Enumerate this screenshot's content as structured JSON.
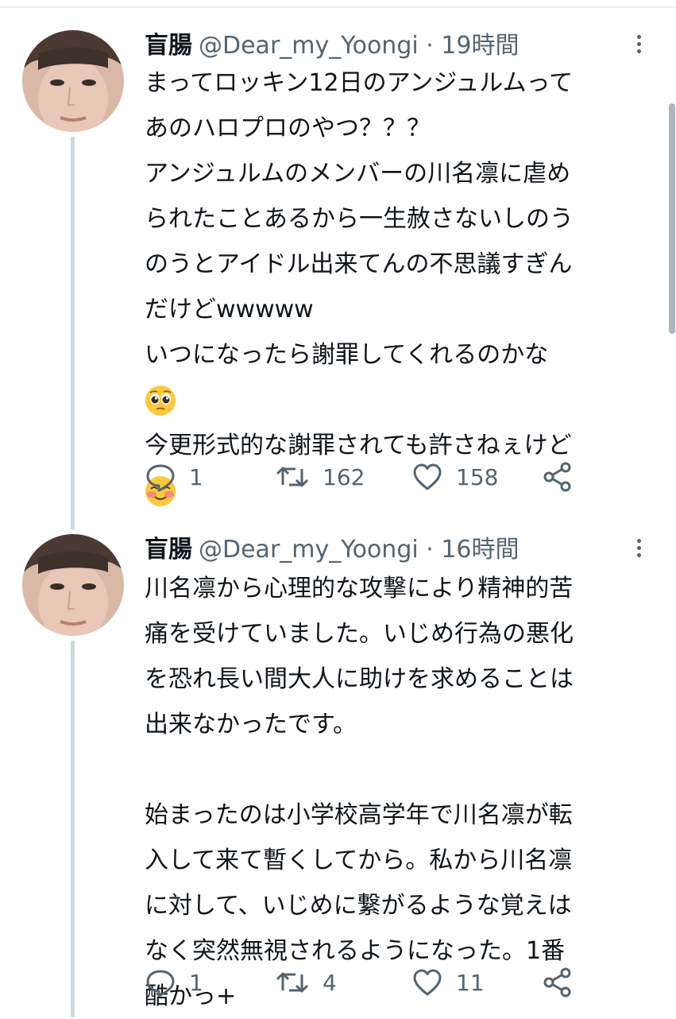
{
  "tweets": [
    {
      "name": "盲腸",
      "handle": "@Dear_my_Yoongi",
      "separator": "·",
      "time": "19時間",
      "lines": [
        "まってロッキン12日のアンジュルムって",
        "あのハロプロのやつ？？？",
        "アンジュルムのメンバーの川名凛に虐め",
        "られたことあるから一生赦さないしのう",
        "のうとアイドル出来てんの不思議すぎん",
        "だけどwwwww",
        "いつになったら謝罪してくれるのかな",
        "",
        "今更形式的な謝罪されても許さねぇけど",
        ""
      ],
      "emojis": [
        "pleading-face",
        "smiling-face-with-blush"
      ],
      "reply_count": "1",
      "retweet_count": "162",
      "like_count": "158"
    },
    {
      "name": "盲腸",
      "handle": "@Dear_my_Yoongi",
      "separator": "·",
      "time": "16時間",
      "lines": [
        "川名凛から心理的な攻撃により精神的苦",
        "痛を受けていました。いじめ行為の悪化",
        "を恐れ長い間大人に助けを求めることは",
        "出来なかったです。",
        "",
        "始まったのは小学校高学年で川名凛が転",
        "入して来て暫くしてから。私から川名凛",
        "に対して、いじめに繋がるような覚えは",
        "なく突然無視されるようになった。1番",
        "酷かっ+"
      ],
      "reply_count": "1",
      "retweet_count": "4",
      "like_count": "11"
    }
  ],
  "icons": [
    "reply-icon",
    "retweet-icon",
    "like-icon",
    "share-icon",
    "more-icon"
  ],
  "colors": {
    "text": "#0f1419",
    "secondary": "#536471",
    "thread_line": "#cfd9de",
    "background": "#ffffff"
  }
}
